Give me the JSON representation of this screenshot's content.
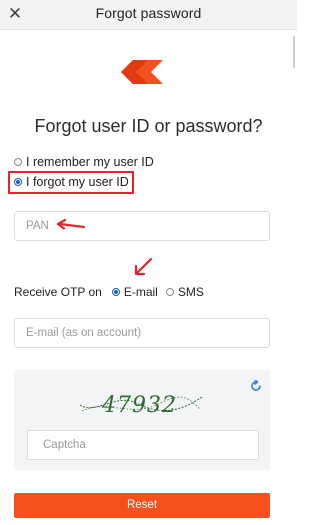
{
  "header": {
    "close_icon": "close-icon",
    "close_glyph": "✕",
    "title": "Forgot password"
  },
  "brand": {
    "logo_icon": "brand-logo",
    "color": "#f4511e"
  },
  "page": {
    "heading": "Forgot user ID or password?"
  },
  "recovery_options": {
    "remember_label": "I remember my user ID",
    "forgot_label": "I forgot my user ID",
    "selected": "forgot"
  },
  "pan": {
    "placeholder": "PAN"
  },
  "otp": {
    "label": "Receive OTP on",
    "options": [
      "E-mail",
      "SMS"
    ],
    "selected": "E-mail"
  },
  "email": {
    "placeholder": "E-mail (as on account)"
  },
  "captcha": {
    "refresh_icon": "refresh-icon",
    "image_text": "47932",
    "placeholder": "Captcha"
  },
  "actions": {
    "reset_label": "Reset"
  },
  "annotation": {
    "highlight_color": "#e3232d",
    "arrow_color": "#e3232d"
  },
  "accent": {
    "radio": "#1a5fd0"
  }
}
